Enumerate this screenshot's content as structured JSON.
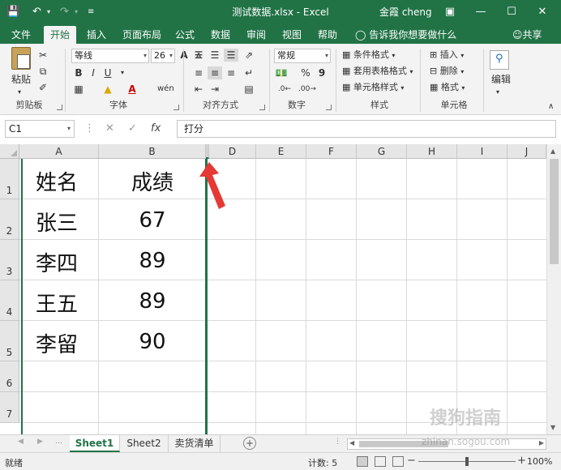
{
  "window": {
    "title": "测试数据.xlsx  -  Excel",
    "user": "金霞 cheng",
    "qa_save_icon": "save-icon",
    "qa_undo_icon": "undo-icon",
    "qa_redo_icon": "redo-icon"
  },
  "tabs": [
    "文件",
    "开始",
    "插入",
    "页面布局",
    "公式",
    "数据",
    "审阅",
    "视图",
    "帮助"
  ],
  "active_tab": "开始",
  "tellme": "告诉我你想要做什么",
  "share": "共享",
  "ribbon": {
    "clipboard": {
      "paste": "粘贴",
      "label": "剪贴板"
    },
    "font": {
      "name": "等线",
      "size": "26",
      "label": "字体",
      "bold": "B",
      "italic": "I",
      "underline": "U",
      "grow": "A",
      "shrink": "A",
      "wen": "wén"
    },
    "alignment": {
      "label": "对齐方式"
    },
    "number": {
      "format": "常规",
      "label": "数字",
      "percent": "%",
      "comma": "9"
    },
    "styles": {
      "cond": "条件格式",
      "table": "套用表格格式",
      "cell": "单元格样式",
      "label": "样式"
    },
    "cells": {
      "insert": "插入",
      "delete": "删除",
      "format": "格式",
      "label": "单元格"
    },
    "editing": {
      "label": "编辑"
    }
  },
  "formula_bar": {
    "namebox": "C1",
    "fx": "fx",
    "value": "打分"
  },
  "grid": {
    "columns": [
      "A",
      "B",
      "D",
      "E",
      "F",
      "G",
      "H",
      "I",
      "J"
    ],
    "selected_column": "C",
    "rows": [
      "1",
      "2",
      "3",
      "4",
      "5",
      "6",
      "7"
    ],
    "cells": [
      [
        "姓名",
        "成绩"
      ],
      [
        "张三",
        "67"
      ],
      [
        "李四",
        "89"
      ],
      [
        "王五",
        "89"
      ],
      [
        "李留",
        "90"
      ]
    ]
  },
  "sheets": [
    "Sheet1",
    "Sheet2",
    "卖货清单"
  ],
  "active_sheet": "Sheet1",
  "status": {
    "ready": "就绪",
    "count": "计数: 5",
    "zoom": "100%",
    "zoom_level": 1.0
  },
  "colors": {
    "accent": "#217346",
    "arrow": "#e53935"
  },
  "watermark": "搜狗指南",
  "watermark_url": "zhinan.sogou.com"
}
